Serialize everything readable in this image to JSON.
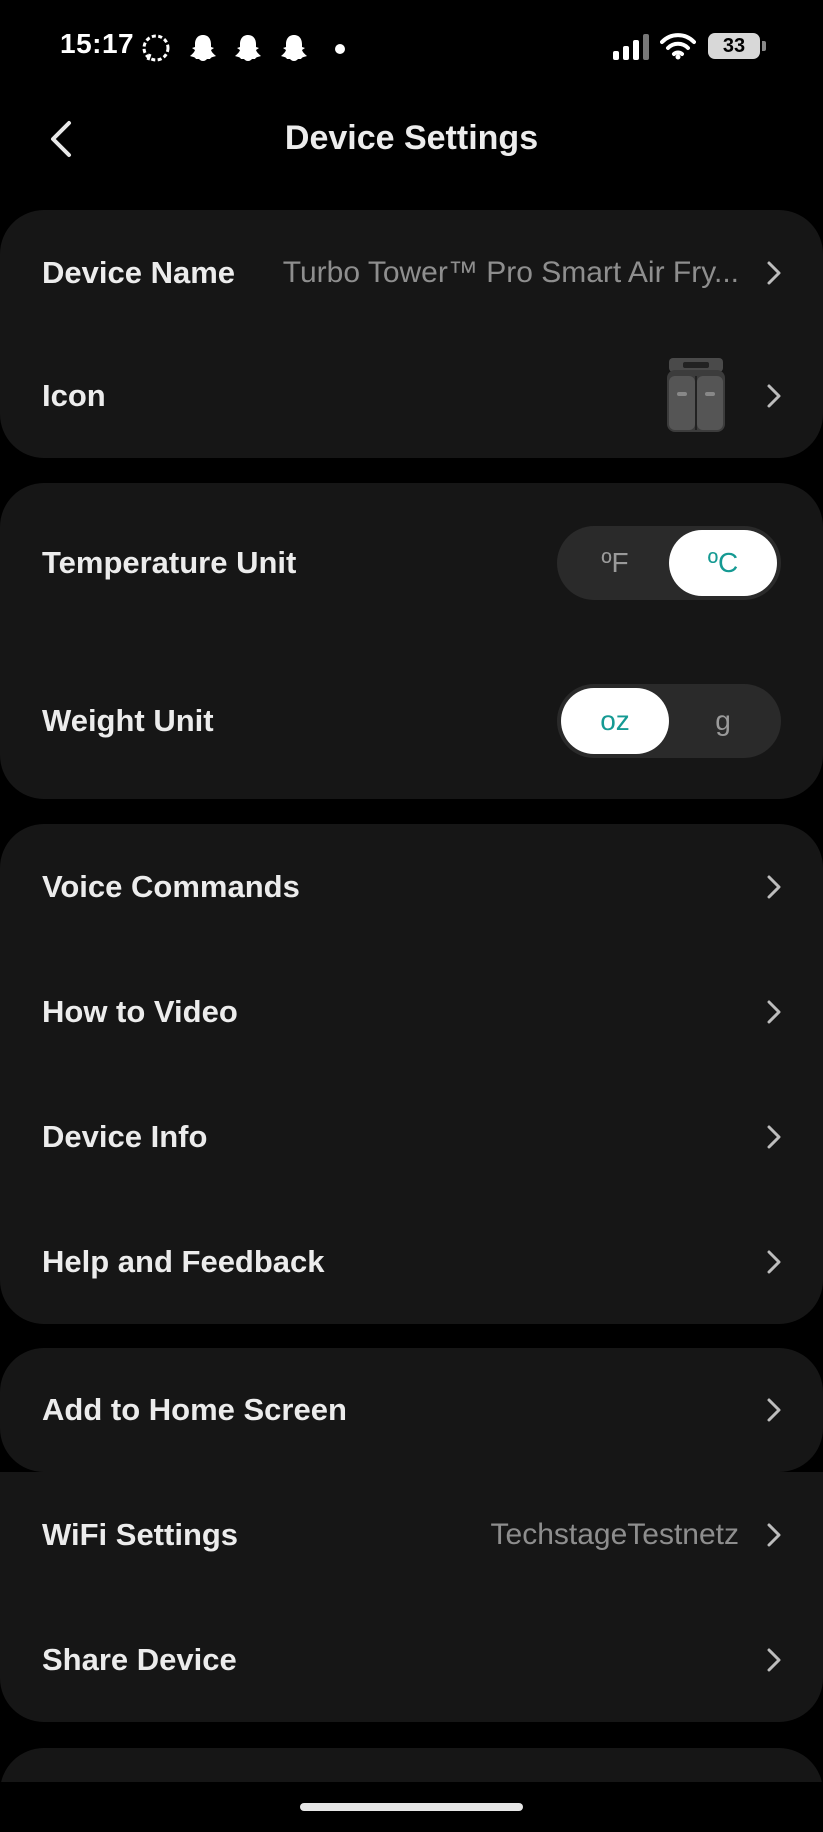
{
  "status_bar": {
    "time": "15:17",
    "notification_icons": [
      "signal-messenger-icon",
      "snapchat-icon",
      "snapchat-icon",
      "snapchat-icon",
      "dot-icon"
    ],
    "battery": "33"
  },
  "header": {
    "title": "Device Settings",
    "back_icon": "chevron-left-icon"
  },
  "sections": {
    "device": {
      "name_label": "Device Name",
      "name_value": "Turbo Tower™ Pro Smart Air Fry...",
      "icon_label": "Icon"
    },
    "units": {
      "temperature_label": "Temperature Unit",
      "temperature_options": [
        "ºF",
        "ºC"
      ],
      "temperature_selected": "ºC",
      "weight_label": "Weight Unit",
      "weight_options": [
        "oz",
        "g"
      ],
      "weight_selected": "oz"
    },
    "help": {
      "voice_commands": "Voice Commands",
      "how_to_video": "How to Video",
      "device_info": "Device Info",
      "help_feedback": "Help and Feedback"
    },
    "home": {
      "add_to_home": "Add to Home Screen"
    },
    "network": {
      "wifi_label": "WiFi Settings",
      "wifi_value": "TechstageTestnetz",
      "share_label": "Share Device"
    }
  },
  "colors": {
    "background": "#000000",
    "card": "#161616",
    "accent": "#159A93",
    "label": "#ECECEC",
    "secondary": "#8E8E8E"
  }
}
